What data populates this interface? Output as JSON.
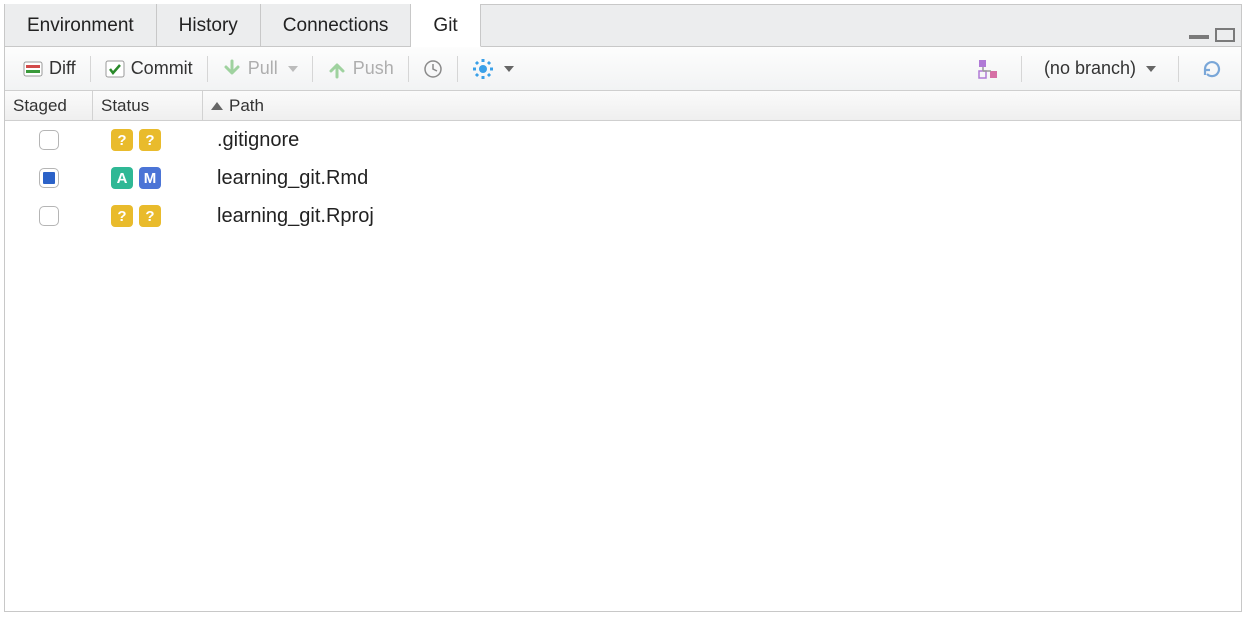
{
  "tabs": {
    "environment": "Environment",
    "history": "History",
    "connections": "Connections",
    "git": "Git"
  },
  "toolbar": {
    "diff": "Diff",
    "commit": "Commit",
    "pull": "Pull",
    "push": "Push",
    "branch": "(no branch)"
  },
  "columns": {
    "staged": "Staged",
    "status": "Status",
    "path": "Path"
  },
  "files": [
    {
      "staged": false,
      "status": [
        "?",
        "?"
      ],
      "path": ".gitignore"
    },
    {
      "staged": true,
      "status": [
        "A",
        "M"
      ],
      "path": "learning_git.Rmd"
    },
    {
      "staged": false,
      "status": [
        "?",
        "?"
      ],
      "path": "learning_git.Rproj"
    }
  ]
}
